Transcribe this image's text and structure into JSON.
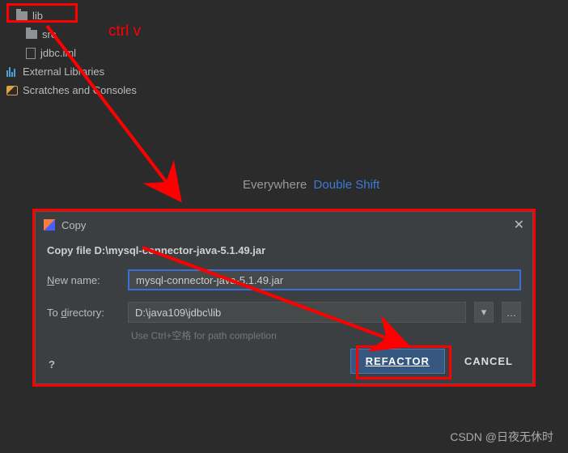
{
  "sidebar": {
    "items": [
      {
        "label": "lib"
      },
      {
        "label": "src"
      },
      {
        "label": "jdbc.iml"
      },
      {
        "label": "External Libraries"
      },
      {
        "label": "Scratches and Consoles"
      }
    ]
  },
  "annotation": {
    "ctrl_v": "ctrl v"
  },
  "hint_bar": {
    "everywhere": "Everywhere",
    "double_shift": "Double Shift"
  },
  "dialog": {
    "title": "Copy",
    "heading": "Copy file D:\\mysql-connector-java-5.1.49.jar",
    "new_name_label_prefix": "N",
    "new_name_label_rest": "ew name:",
    "new_name_value": "mysql-connector-java-5.1.49.jar",
    "to_dir_label_prefix": "To ",
    "to_dir_label_under": "d",
    "to_dir_label_rest": "irectory:",
    "to_dir_value": "D:\\java109\\jdbc\\lib",
    "hint": "Use Ctrl+空格 for path completion",
    "help": "?",
    "refactor": "REFACTOR",
    "cancel": "CANCEL"
  },
  "watermark": "CSDN @日夜无休时"
}
